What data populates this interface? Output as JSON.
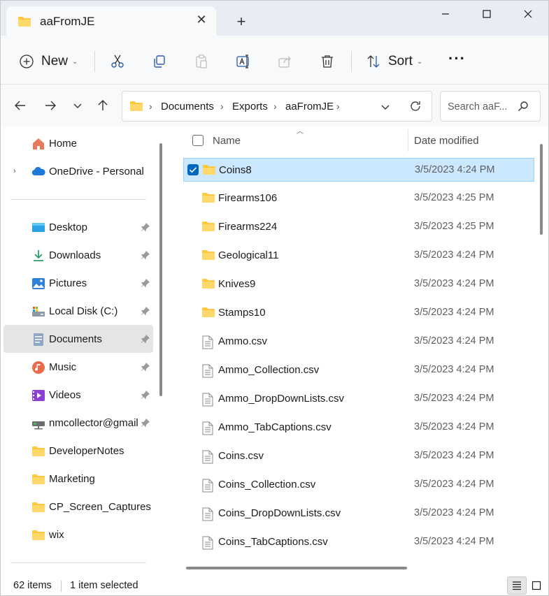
{
  "tab": {
    "title": "aaFromJE",
    "close_glyph": "✕",
    "new_tab_glyph": "+"
  },
  "toolbar": {
    "new_label": "New",
    "sort_label": "Sort",
    "more_glyph": "···"
  },
  "breadcrumb": [
    "Documents",
    "Exports",
    "aaFromJE"
  ],
  "search": {
    "placeholder": "Search aaF..."
  },
  "nav": {
    "home": "Home",
    "onedrive": "OneDrive - Personal",
    "quick": [
      {
        "label": "Desktop",
        "icon": "desktop-icon"
      },
      {
        "label": "Downloads",
        "icon": "download-icon"
      },
      {
        "label": "Pictures",
        "icon": "pictures-icon"
      },
      {
        "label": "Local Disk (C:)",
        "icon": "drive-icon"
      },
      {
        "label": "Documents",
        "icon": "documents-icon"
      },
      {
        "label": "Music",
        "icon": "music-icon"
      },
      {
        "label": "Videos",
        "icon": "videos-icon"
      },
      {
        "label": "nmcollector@gmail",
        "icon": "network-drive-icon"
      },
      {
        "label": "DeveloperNotes",
        "icon": "folder-icon"
      },
      {
        "label": "Marketing",
        "icon": "folder-icon"
      },
      {
        "label": "CP_Screen_Captures",
        "icon": "folder-icon"
      },
      {
        "label": "wix",
        "icon": "folder-icon"
      }
    ]
  },
  "columns": {
    "name": "Name",
    "date": "Date modified"
  },
  "files": [
    {
      "name": "Coins8",
      "date": "3/5/2023 4:24 PM",
      "type": "folder",
      "selected": true
    },
    {
      "name": "Firearms106",
      "date": "3/5/2023 4:25 PM",
      "type": "folder"
    },
    {
      "name": "Firearms224",
      "date": "3/5/2023 4:25 PM",
      "type": "folder"
    },
    {
      "name": "Geological11",
      "date": "3/5/2023 4:24 PM",
      "type": "folder"
    },
    {
      "name": "Knives9",
      "date": "3/5/2023 4:24 PM",
      "type": "folder"
    },
    {
      "name": "Stamps10",
      "date": "3/5/2023 4:24 PM",
      "type": "folder"
    },
    {
      "name": "Ammo.csv",
      "date": "3/5/2023 4:24 PM",
      "type": "file"
    },
    {
      "name": "Ammo_Collection.csv",
      "date": "3/5/2023 4:24 PM",
      "type": "file"
    },
    {
      "name": "Ammo_DropDownLists.csv",
      "date": "3/5/2023 4:24 PM",
      "type": "file"
    },
    {
      "name": "Ammo_TabCaptions.csv",
      "date": "3/5/2023 4:24 PM",
      "type": "file"
    },
    {
      "name": "Coins.csv",
      "date": "3/5/2023 4:24 PM",
      "type": "file"
    },
    {
      "name": "Coins_Collection.csv",
      "date": "3/5/2023 4:24 PM",
      "type": "file"
    },
    {
      "name": "Coins_DropDownLists.csv",
      "date": "3/5/2023 4:24 PM",
      "type": "file"
    },
    {
      "name": "Coins_TabCaptions.csv",
      "date": "3/5/2023 4:24 PM",
      "type": "file"
    }
  ],
  "status": {
    "count": "62 items",
    "selected": "1 item selected"
  },
  "colors": {
    "selection": "#cce8ff",
    "accent": "#0067c0",
    "folder": "#ffc83d"
  }
}
